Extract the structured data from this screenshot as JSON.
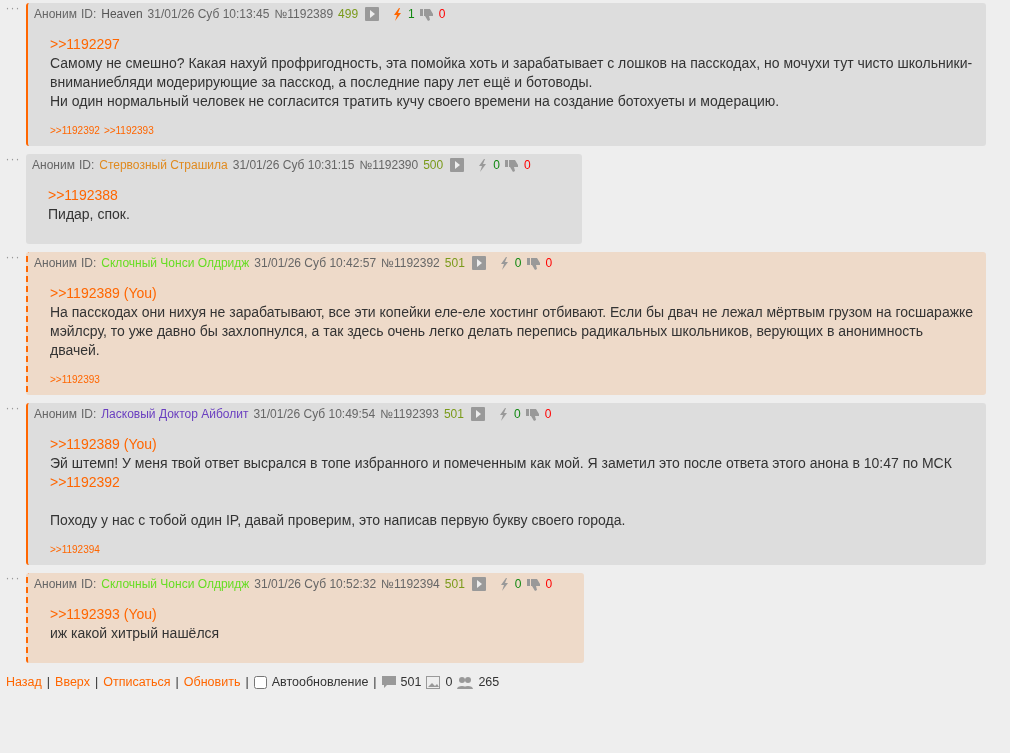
{
  "posts": [
    {
      "menu": "···",
      "author": "Аноним",
      "id_label": "ID:",
      "poster_id": "Heaven",
      "color": "#555555",
      "date": "31/01/26 Суб 10:13:45",
      "number": "№1192389",
      "index": "499",
      "likes": "1",
      "liked": true,
      "dislikes": "0",
      "kind": "own",
      "highlighted": false,
      "reply_to": {
        "link": ">>1192297"
      },
      "paragraphs": [
        {
          "text": "Самому не смешно? Какая нахуй профригодность, эта помойка хоть и зарабатывает с лошков на пасскодах, но мочухи тут чисто школьники-вниманиебляди модерирующие за пасскод, а последние пару лет ещё и ботоводы.\nНи один нормальный человек не согласится тратить кучу своего времени на создание ботохуеты и модерацию."
        }
      ],
      "replies": [
        ">>1192392",
        ">>1192393"
      ]
    },
    {
      "menu": "···",
      "author": "Аноним",
      "id_label": "ID:",
      "poster_id": "Стервозный Страшила",
      "color": "#e08a1e",
      "date": "31/01/26 Суб 10:31:15",
      "number": "№1192390",
      "index": "500",
      "likes": "0",
      "liked": false,
      "dislikes": "0",
      "kind": "plain",
      "highlighted": false,
      "reply_to": {
        "link": ">>1192388"
      },
      "paragraphs": [
        {
          "text": "Пидар, спок."
        }
      ]
    },
    {
      "menu": "···",
      "author": "Аноним",
      "id_label": "ID:",
      "poster_id": "Склочный Чонси Олдридж",
      "color": "#66dd22",
      "date": "31/01/26 Суб 10:42:57",
      "number": "№1192392",
      "index": "501",
      "likes": "0",
      "liked": false,
      "dislikes": "0",
      "kind": "reply",
      "highlighted": true,
      "reply_to": {
        "link": ">>1192389",
        "you": "(You)"
      },
      "paragraphs": [
        {
          "text": "На пасскодах они нихуя не зарабатывают, все эти копейки еле-еле хостинг отбивают. Если бы двач не лежал мёртвым грузом на госшаражке мэйлсру, то уже давно бы захлопнулся, а так здесь очень легко делать перепись радикальных школьников, верующих в анонимность двачей."
        }
      ],
      "replies": [
        ">>1192393"
      ]
    },
    {
      "menu": "···",
      "author": "Аноним",
      "id_label": "ID:",
      "poster_id": "Ласковый Доктор Айболит",
      "color": "#6a3fc0",
      "date": "31/01/26 Суб 10:49:54",
      "number": "№1192393",
      "index": "501",
      "likes": "0",
      "liked": false,
      "dislikes": "0",
      "kind": "own",
      "highlighted": false,
      "reply_to": {
        "link": ">>1192389",
        "you": "(You)"
      },
      "paragraphs": [
        {
          "text": "Эй штемп! У меня твой ответ высрался в топе избранного и помеченным как мой. Я заметил это после ответа этого анона в 10:47 по МСК",
          "link": ">>1192392"
        },
        {
          "text": "Походу у нас с тобой один IP, давай проверим, это написав первую букву своего города."
        }
      ],
      "replies": [
        ">>1192394"
      ]
    },
    {
      "menu": "···",
      "author": "Аноним",
      "id_label": "ID:",
      "poster_id": "Склочный Чонси Олдридж",
      "color": "#66dd22",
      "date": "31/01/26 Суб 10:52:32",
      "number": "№1192394",
      "index": "501",
      "likes": "0",
      "liked": false,
      "dislikes": "0",
      "kind": "reply",
      "highlighted": true,
      "reply_to": {
        "link": ">>1192393",
        "you": "(You)"
      },
      "paragraphs": [
        {
          "text": "иж какой хитрый нашёлся"
        }
      ]
    }
  ],
  "footer": {
    "links": [
      "Назад",
      "Вверх",
      "Отписаться",
      "Обновить"
    ],
    "separator": "|",
    "autoupdate": {
      "label": "Автообновление",
      "checked": false
    },
    "posts_count": "501",
    "images_count": "0",
    "posters_count": "265"
  }
}
